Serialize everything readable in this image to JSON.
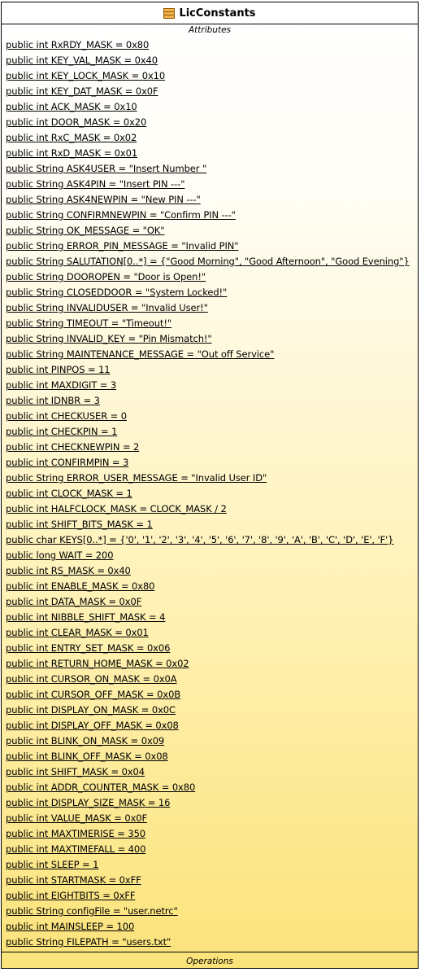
{
  "class": {
    "name": "LicConstants",
    "attributes_label": "Attributes",
    "operations_label": "Operations",
    "attributes": [
      "public int RxRDY_MASK = 0x80",
      "public int KEY_VAL_MASK = 0x40",
      "public int KEY_LOCK_MASK = 0x10",
      "public int KEY_DAT_MASK = 0x0F",
      "public int ACK_MASK = 0x10",
      "public int DOOR_MASK = 0x20",
      "public int RxC_MASK = 0x02",
      "public int RxD_MASK = 0x01",
      "public String ASK4USER = \"Insert Number  \"",
      "public String ASK4PIN = \"Insert PIN ---\"",
      "public String ASK4NEWPIN = \"New PIN ---\"",
      "public String CONFIRMNEWPIN = \"Confirm PIN ---\"",
      "public String OK_MESSAGE = \"OK\"",
      "public String ERROR_PIN_MESSAGE = \"Invalid PIN\"",
      "public String SALUTATION[0..*] = {\"Good Morning\", \"Good Afternoon\", \"Good Evening\"}",
      "public String DOOROPEN = \"Door is Open!\"",
      "public String CLOSEDDOOR = \"System Locked!\"",
      "public String INVALIDUSER = \"Invalid User!\"",
      "public String TIMEOUT = \"Timeout!\"",
      "public String INVALID_KEY = \"Pin Mismatch!\"",
      "public String MAINTENANCE_MESSAGE = \"Out off Service\"",
      "public int PINPOS = 11",
      "public int MAXDIGIT = 3",
      "public int IDNBR = 3",
      "public int CHECKUSER = 0",
      "public int CHECKPIN = 1",
      "public int CHECKNEWPIN = 2",
      "public int CONFIRMPIN = 3",
      "public String ERROR_USER_MESSAGE = \"Invalid User ID\"",
      "public int CLOCK_MASK = 1",
      "public int HALFCLOCK_MASK = CLOCK_MASK / 2",
      "public int SHIFT_BITS_MASK = 1",
      "public char KEYS[0..*] = {'0', '1', '2', '3', '4', '5', '6', '7', '8', '9', 'A', 'B', 'C', 'D', 'E', 'F'}",
      "public long WAIT = 200",
      "public int RS_MASK = 0x40",
      "public int ENABLE_MASK = 0x80",
      "public int DATA_MASK = 0x0F",
      "public int NIBBLE_SHIFT_MASK = 4",
      "public int CLEAR_MASK = 0x01",
      "public int ENTRY_SET_MASK = 0x06",
      "public int RETURN_HOME_MASK = 0x02",
      "public int CURSOR_ON_MASK = 0x0A",
      "public int CURSOR_OFF_MASK = 0x0B",
      "public int DISPLAY_ON_MASK = 0x0C",
      "public int DISPLAY_OFF_MASK = 0x08",
      "public int BLINK_ON_MASK = 0x09",
      "public int BLINK_OFF_MASK = 0x08",
      "public int SHIFT_MASK = 0x04",
      "public int ADDR_COUNTER_MASK = 0x80",
      "public int DISPLAY_SIZE_MASK = 16",
      "public int VALUE_MASK = 0x0F",
      "public int MAXTIMERISE = 350",
      "public int MAXTIMEFALL = 400",
      "public int SLEEP = 1",
      "public int STARTMASK = 0xFF",
      "public int EIGHTBITS = 0xFF",
      "public String configFile = \"user.netrc\"",
      "public int MAINSLEEP = 100",
      "public String FILEPATH = \"users.txt\""
    ]
  },
  "colors": {
    "border": "#000000",
    "fill_top": "#ffffff",
    "fill_bottom": "#fbe37a",
    "icon_fill": "#f6b24a"
  },
  "icons": {
    "class_icon": "uml-class-icon"
  }
}
